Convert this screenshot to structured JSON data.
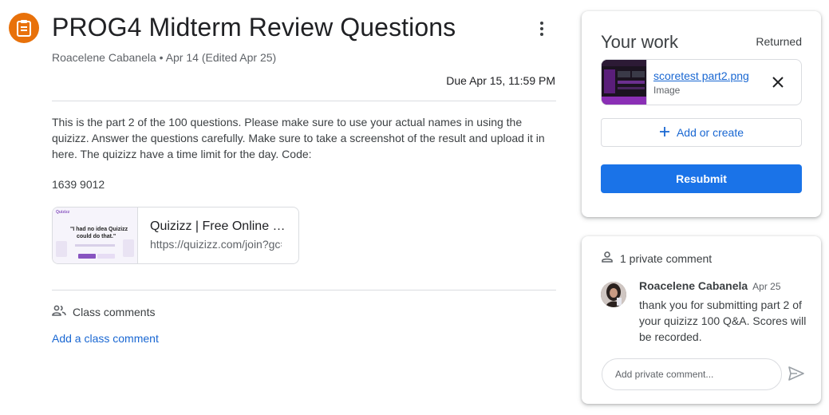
{
  "assignment": {
    "title": "PROG4 Midterm Review Questions",
    "author": "Roacelene Cabanela",
    "separator": "•",
    "posted": "Apr 14 (Edited Apr 25)",
    "due": "Due Apr 15, 11:59 PM",
    "description": "This is the part 2 of the 100 questions. Please make sure to use your actual names in using the quizizz. Answer the questions carefully. Make sure to take a screenshot of the result and upload it in here. The quizizz have a time limit for the day. Code:",
    "code": "1639 9012",
    "icon": "assignment-icon",
    "accent": "#e8710a"
  },
  "link": {
    "title": "Quizizz | Free Online Quizzes",
    "url": "https://quizizz.com/join?gc=16399012",
    "thumb_text": [
      "Quizizz",
      "\"I had no idea Quizizz",
      "could do that.\""
    ]
  },
  "class_comments": {
    "heading": "Class comments",
    "add_label": "Add a class comment"
  },
  "your_work": {
    "title": "Your work",
    "status": "Returned",
    "attachment": {
      "name": "scoretest part2.png",
      "type": "Image"
    },
    "add_label": "Add or create",
    "resubmit_label": "Resubmit",
    "primary_color": "#1a73e8"
  },
  "private_comments": {
    "heading": "1 private comment",
    "comment": {
      "author": "Roacelene Cabanela",
      "date": "Apr 25",
      "text": "thank you for submitting part 2 of your quizizz 100 Q&A. Scores will be recorded."
    },
    "placeholder": "Add private comment..."
  }
}
